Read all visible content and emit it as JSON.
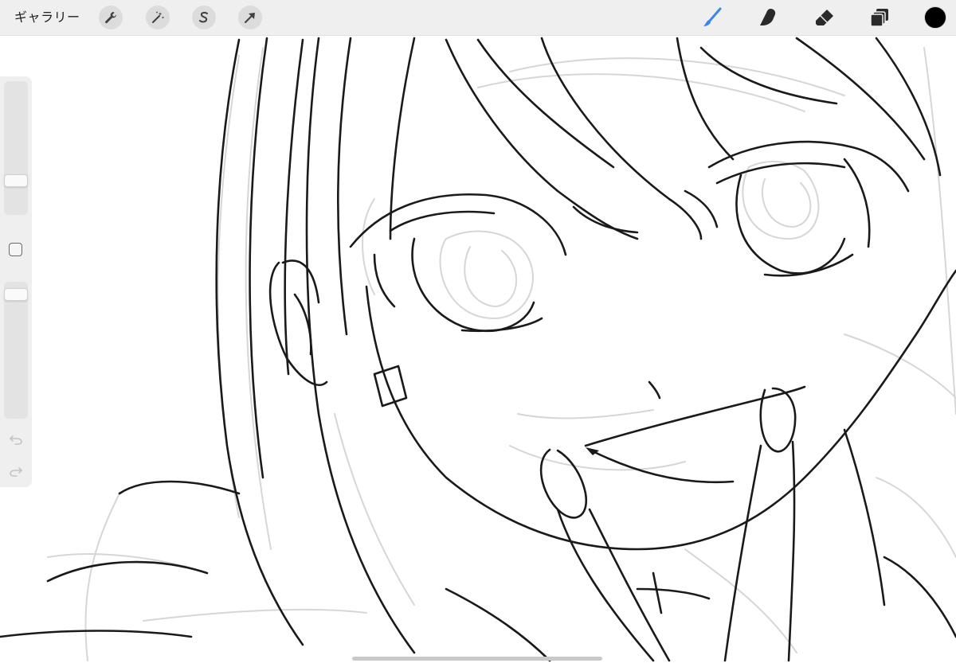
{
  "toolbar": {
    "gallery_label": "ギャラリー",
    "left_tools": [
      {
        "name": "actions",
        "icon": "wrench-icon"
      },
      {
        "name": "adjustments",
        "icon": "magic-wand-icon"
      },
      {
        "name": "selection",
        "icon": "selection-s-icon"
      },
      {
        "name": "transform",
        "icon": "arrow-cursor-icon"
      }
    ],
    "right_tools": [
      {
        "name": "brush",
        "icon": "brush-icon",
        "active": true
      },
      {
        "name": "smudge",
        "icon": "smudge-finger-icon"
      },
      {
        "name": "eraser",
        "icon": "eraser-icon"
      },
      {
        "name": "layers",
        "icon": "layers-icon"
      }
    ],
    "current_color": "#000000",
    "active_tool_color": "#3b86e8"
  },
  "sidebar": {
    "brush_size_level": 0.23,
    "opacity_level": 0.95,
    "controls": [
      "modify-square-icon",
      "undo-icon",
      "redo-icon"
    ]
  },
  "colors": {
    "toolbar_bg": "#efefef",
    "line_art": "#1a1a1a",
    "sketch": "#d4d4d4"
  }
}
